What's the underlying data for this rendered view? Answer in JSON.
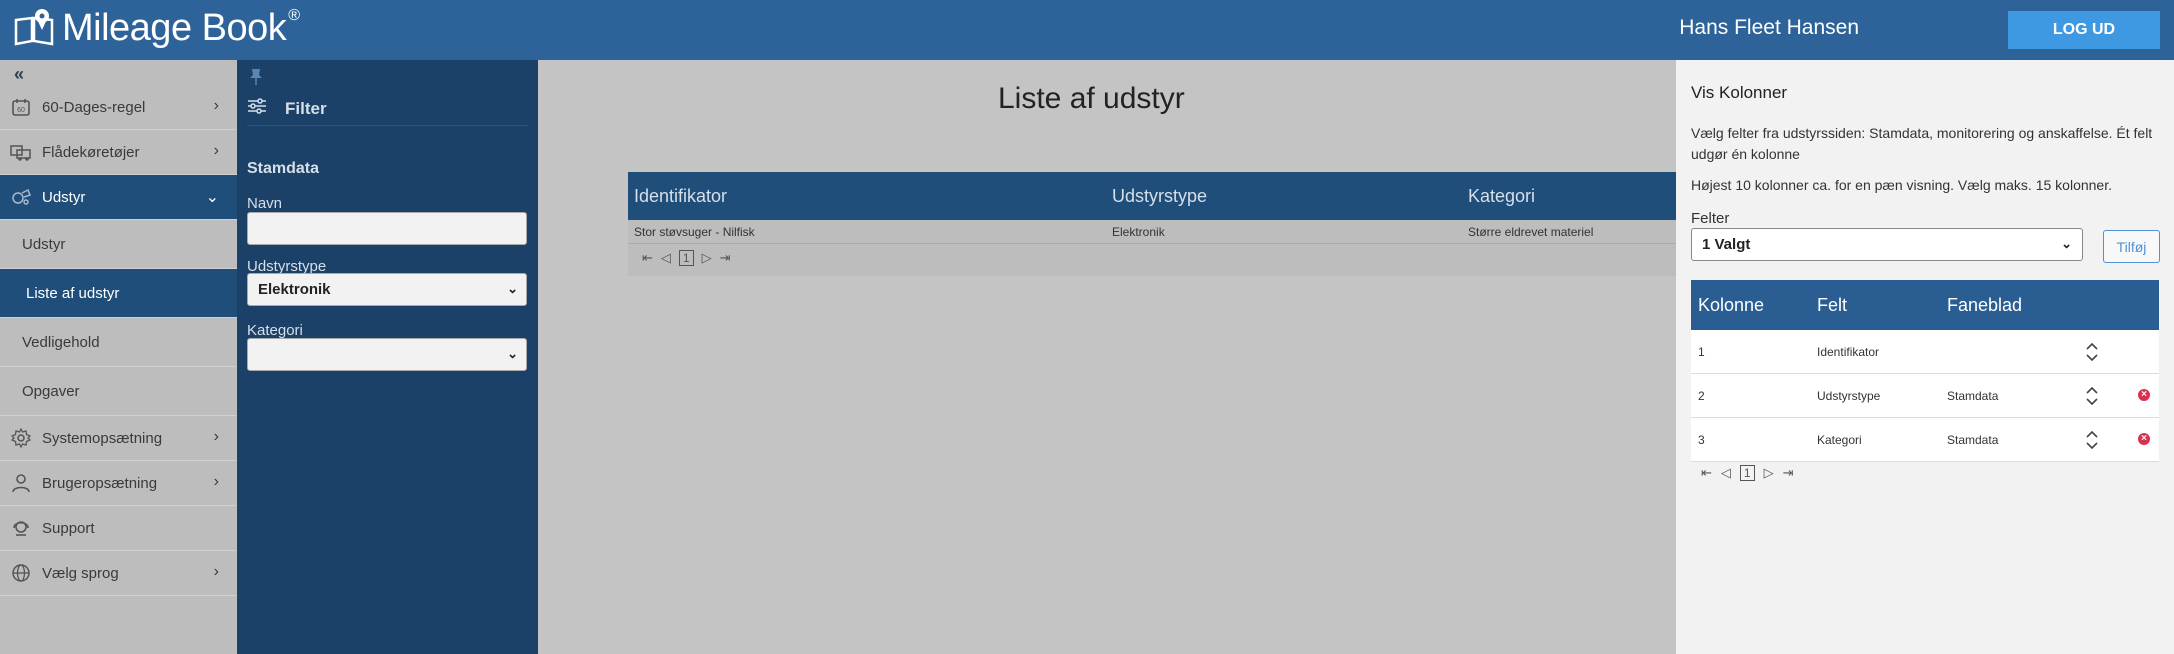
{
  "header": {
    "app_name": "Mileage Book",
    "registered": "®",
    "user_name": "Hans Fleet Hansen",
    "logout_label": "LOG UD"
  },
  "sidebar": {
    "collapse_glyph": "«",
    "items": [
      {
        "label": "60-Dages-regel",
        "icon": "calendar-60-icon",
        "has_children": true
      },
      {
        "label": "Flådekøretøjer",
        "icon": "fleet-vehicles-icon",
        "has_children": true
      },
      {
        "label": "Udstyr",
        "icon": "equipment-icon",
        "has_children": true,
        "expanded": true
      },
      {
        "label": "Systemopsætning",
        "icon": "gear-icon",
        "has_children": true
      },
      {
        "label": "Brugeropsætning",
        "icon": "user-icon",
        "has_children": true
      },
      {
        "label": "Support",
        "icon": "headset-icon",
        "has_children": false
      },
      {
        "label": "Vælg sprog",
        "icon": "globe-icon",
        "has_children": true
      }
    ],
    "sub_items": [
      {
        "label": "Udstyr"
      },
      {
        "label": "Liste af udstyr",
        "current": true
      },
      {
        "label": "Vedligehold"
      },
      {
        "label": "Opgaver"
      }
    ]
  },
  "filter": {
    "title": "Filter",
    "section": "Stamdata",
    "fields": {
      "name_label": "Navn",
      "name_value": "",
      "type_label": "Udstyrstype",
      "type_value": "Elektronik",
      "category_label": "Kategori",
      "category_value": ""
    }
  },
  "main": {
    "title": "Liste af udstyr",
    "columns": [
      "Identifikator",
      "Udstyrstype",
      "Kategori"
    ],
    "rows": [
      [
        "Stor støvsuger - Nilfisk",
        "Elektronik",
        "Større eldrevet materiel"
      ]
    ],
    "pager": {
      "page": "1"
    }
  },
  "drawer": {
    "title": "Vis Kolonner",
    "text1": "Vælg felter fra udstyrssiden: Stamdata, monitorering og anskaffelse. Ét felt udgør én kolonne",
    "text2": "Højest 10 kolonner ca. for en pæn visning. Vælg maks. 15 kolonner.",
    "fields_label": "Felter",
    "fields_value": "1 Valgt",
    "add_label": "Tilføj",
    "columns": [
      "Kolonne",
      "Felt",
      "Faneblad"
    ],
    "rows": [
      {
        "kolonne": "1",
        "felt": "Identifikator",
        "faneblad": "",
        "removable": false
      },
      {
        "kolonne": "2",
        "felt": "Udstyrstype",
        "faneblad": "Stamdata",
        "removable": true
      },
      {
        "kolonne": "3",
        "felt": "Kategori",
        "faneblad": "Stamdata",
        "removable": true
      }
    ],
    "pager": {
      "page": "1"
    }
  },
  "colors": {
    "header": "#2d6399",
    "accent": "#3f98e2",
    "nav_active": "#1f4e7a",
    "filter_panel": "#1b4168",
    "delete": "#d9314f"
  }
}
